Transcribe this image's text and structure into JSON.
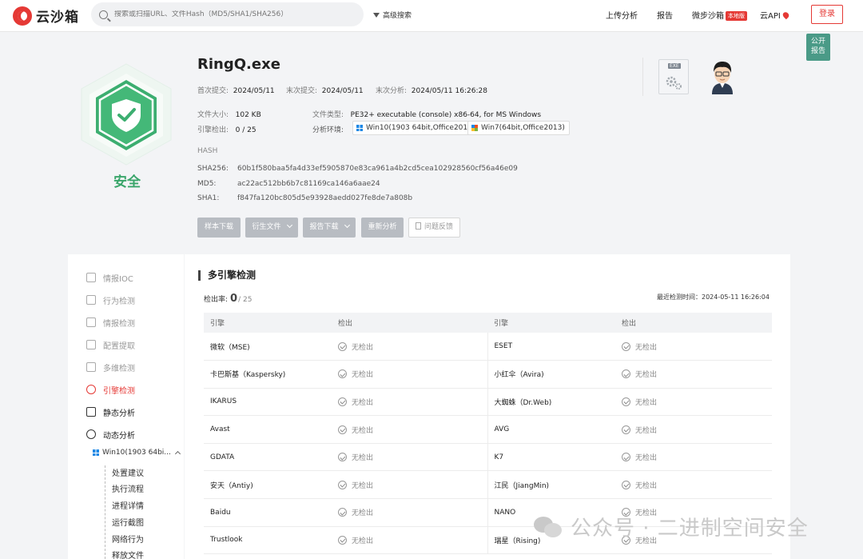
{
  "header": {
    "logo_text": "云沙箱",
    "search_placeholder": "搜索或扫描URL、文件Hash（MD5/SHA1/SHA256）",
    "advanced_search": "高级搜索",
    "nav": {
      "upload": "上传分析",
      "report": "报告",
      "micro_sandbox": "微步沙箱",
      "local_badge": "本地版",
      "cloud_api": "云API",
      "login": "登录"
    },
    "public_report_line1": "公开",
    "public_report_line2": "报告"
  },
  "summary": {
    "verdict": "安全",
    "file_name": "RingQ.exe",
    "first_submit_label": "首次提交:",
    "first_submit": "2024/05/11",
    "last_submit_label": "末次提交:",
    "last_submit": "2024/05/11",
    "last_analysis_label": "末次分析:",
    "last_analysis": "2024/05/11 16:26:28",
    "size_label": "文件大小:",
    "size": "102 KB",
    "type_label": "文件类型:",
    "type": "PE32+ executable (console) x86-64, for MS Windows",
    "engine_label": "引擎检出:",
    "engine": "0 / 25",
    "env_label": "分析环境:",
    "env1": "Win10(1903 64bit,Office2016)",
    "env2": "Win7(64bit,Office2013)",
    "hash_title": "HASH",
    "sha256_label": "SHA256:",
    "sha256": "60b1f580baa5fa4d33ef5905870e83ca961a4b2cd5cea102928560cf56a46e09",
    "md5_label": "MD5:",
    "md5": "ac22ac512bb6b7c81169ca146a6aae24",
    "sha1_label": "SHA1:",
    "sha1": "f847fa120bc805d5e93928aedd027fe8de7a808b",
    "thumb_tag": "EXE",
    "buttons": {
      "download": "样本下载",
      "derived": "衍生文件",
      "report_dl": "报告下载",
      "reanalyze": "重新分析",
      "feedback": "问题反馈"
    }
  },
  "sidebar": {
    "items": [
      "情报IOC",
      "行为检测",
      "情报检测",
      "配置提取",
      "多维检测",
      "引擎检测",
      "静态分析",
      "动态分析"
    ],
    "env_sub": "Win10(1903 64bi...",
    "tree": [
      "处置建议",
      "执行流程",
      "进程详情",
      "运行截图",
      "网络行为",
      "释放文件"
    ]
  },
  "engines": {
    "title": "多引擎检测",
    "rate_label": "检出率:",
    "rate_num": "0",
    "rate_total": "/ 25",
    "last_time": "最近检测时间：2024-05-11 16:26:04",
    "headers": [
      "引擎",
      "检出",
      "引擎",
      "检出"
    ],
    "no_detect": "无检出",
    "rows": [
      [
        "微软（MSE)",
        "ESET"
      ],
      [
        "卡巴斯基（Kaspersky)",
        "小红伞（Avira)"
      ],
      [
        "IKARUS",
        "大蜘蛛（Dr.Web)"
      ],
      [
        "Avast",
        "AVG"
      ],
      [
        "GDATA",
        "K7"
      ],
      [
        "安天（Antiy)",
        "江民（JiangMin)"
      ],
      [
        "Baidu",
        "NANO"
      ],
      [
        "Trustlook",
        "瑞星（Rising)"
      ]
    ]
  },
  "watermark": "公众号 · 二进制空间安全"
}
